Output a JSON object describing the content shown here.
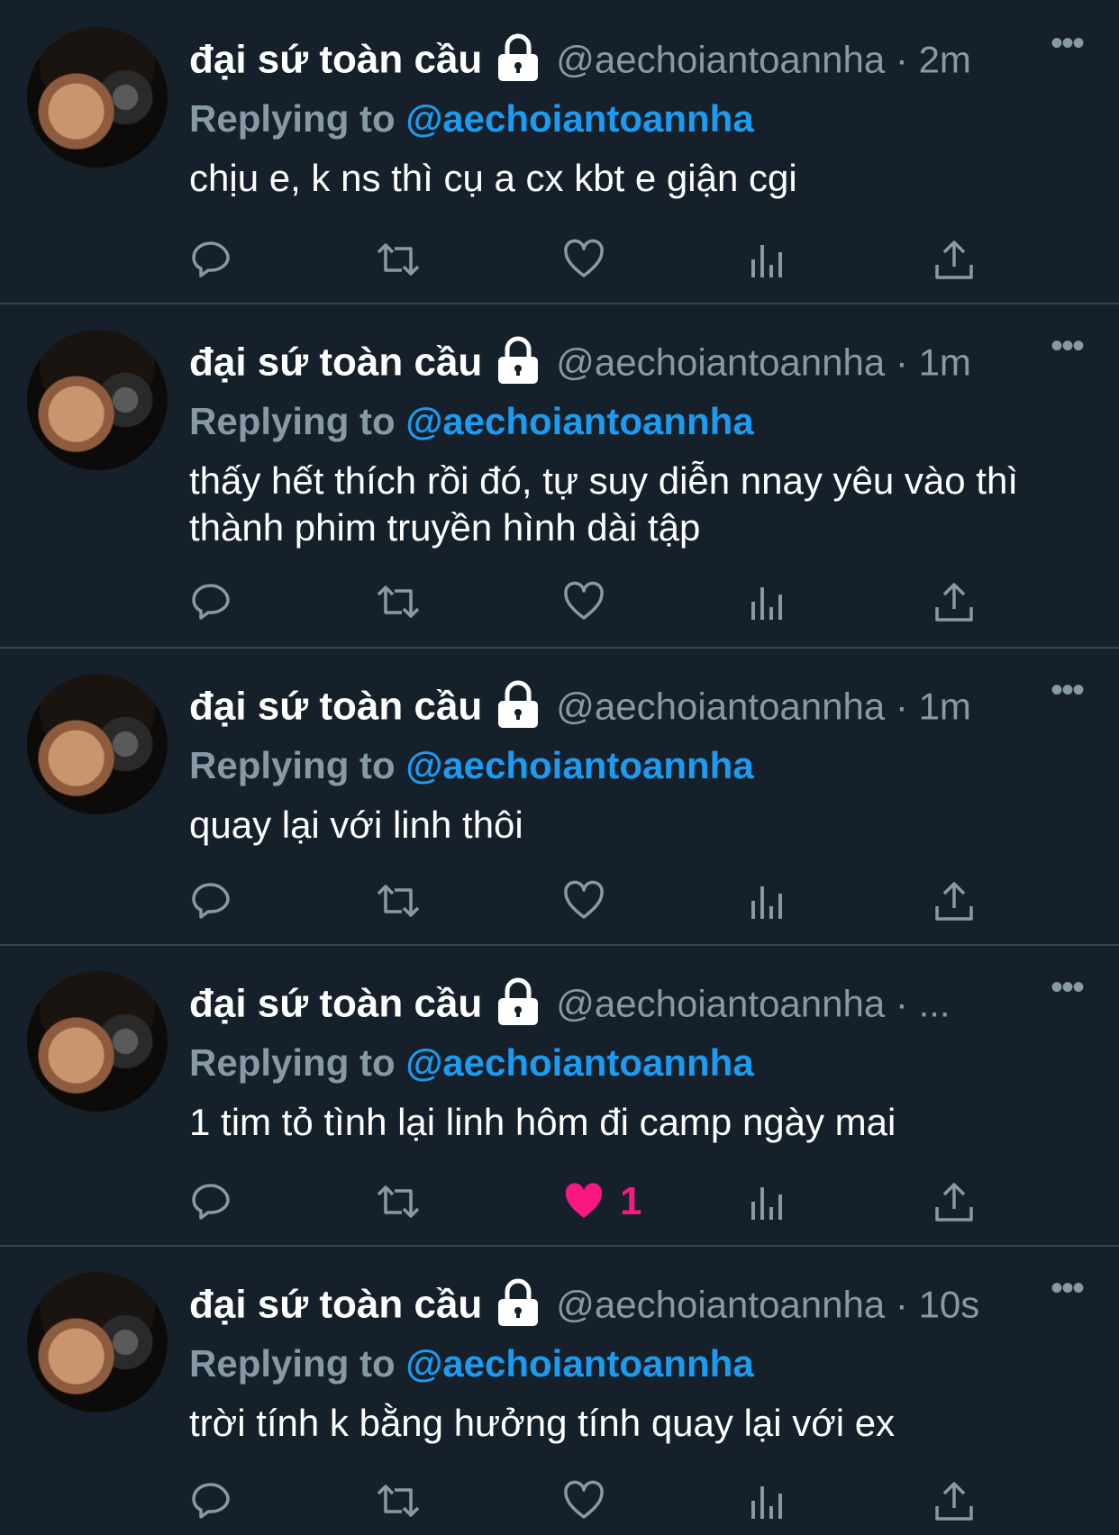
{
  "tweets": [
    {
      "name": "đại sứ toàn cầu",
      "handle": "@aechoiantoannha",
      "time": "2m",
      "replying_prefix": "Replying to",
      "replying_mention": "@aechoiantoannha",
      "text": "chịu e, k ns thì cụ a cx kbt e giận cgi",
      "liked": false,
      "like_count": ""
    },
    {
      "name": "đại sứ toàn cầu",
      "handle": "@aechoiantoannha",
      "time": "1m",
      "replying_prefix": "Replying to",
      "replying_mention": "@aechoiantoannha",
      "text": "thấy hết thích rồi đó, tự suy diễn nnay yêu vào thì thành phim truyền hình dài tập",
      "liked": false,
      "like_count": ""
    },
    {
      "name": "đại sứ toàn cầu",
      "handle": "@aechoiantoannha",
      "time": "1m",
      "replying_prefix": "Replying to",
      "replying_mention": "@aechoiantoannha",
      "text": "quay lại với linh thôi",
      "liked": false,
      "like_count": ""
    },
    {
      "name": "đại sứ toàn cầu",
      "handle": "@aechoiantoannha",
      "time": "...",
      "replying_prefix": "Replying to",
      "replying_mention": "@aechoiantoannha",
      "text": "1 tim tỏ tình lại linh hôm đi camp ngày mai",
      "liked": true,
      "like_count": "1"
    },
    {
      "name": "đại sứ toàn cầu",
      "handle": "@aechoiantoannha",
      "time": "10s",
      "replying_prefix": "Replying to",
      "replying_mention": "@aechoiantoannha",
      "text": "trời tính k bằng hưởng tính quay lại với ex",
      "liked": false,
      "like_count": ""
    }
  ],
  "separator": "·",
  "more_glyph": "•••",
  "colors": {
    "background": "#15202b",
    "muted": "#8899a6",
    "link": "#1d9bf0",
    "like": "#f91880",
    "divider": "#38444d"
  },
  "icons": [
    "reply-icon",
    "retweet-icon",
    "like-icon",
    "views-icon",
    "share-icon",
    "lock-icon",
    "more-icon"
  ]
}
